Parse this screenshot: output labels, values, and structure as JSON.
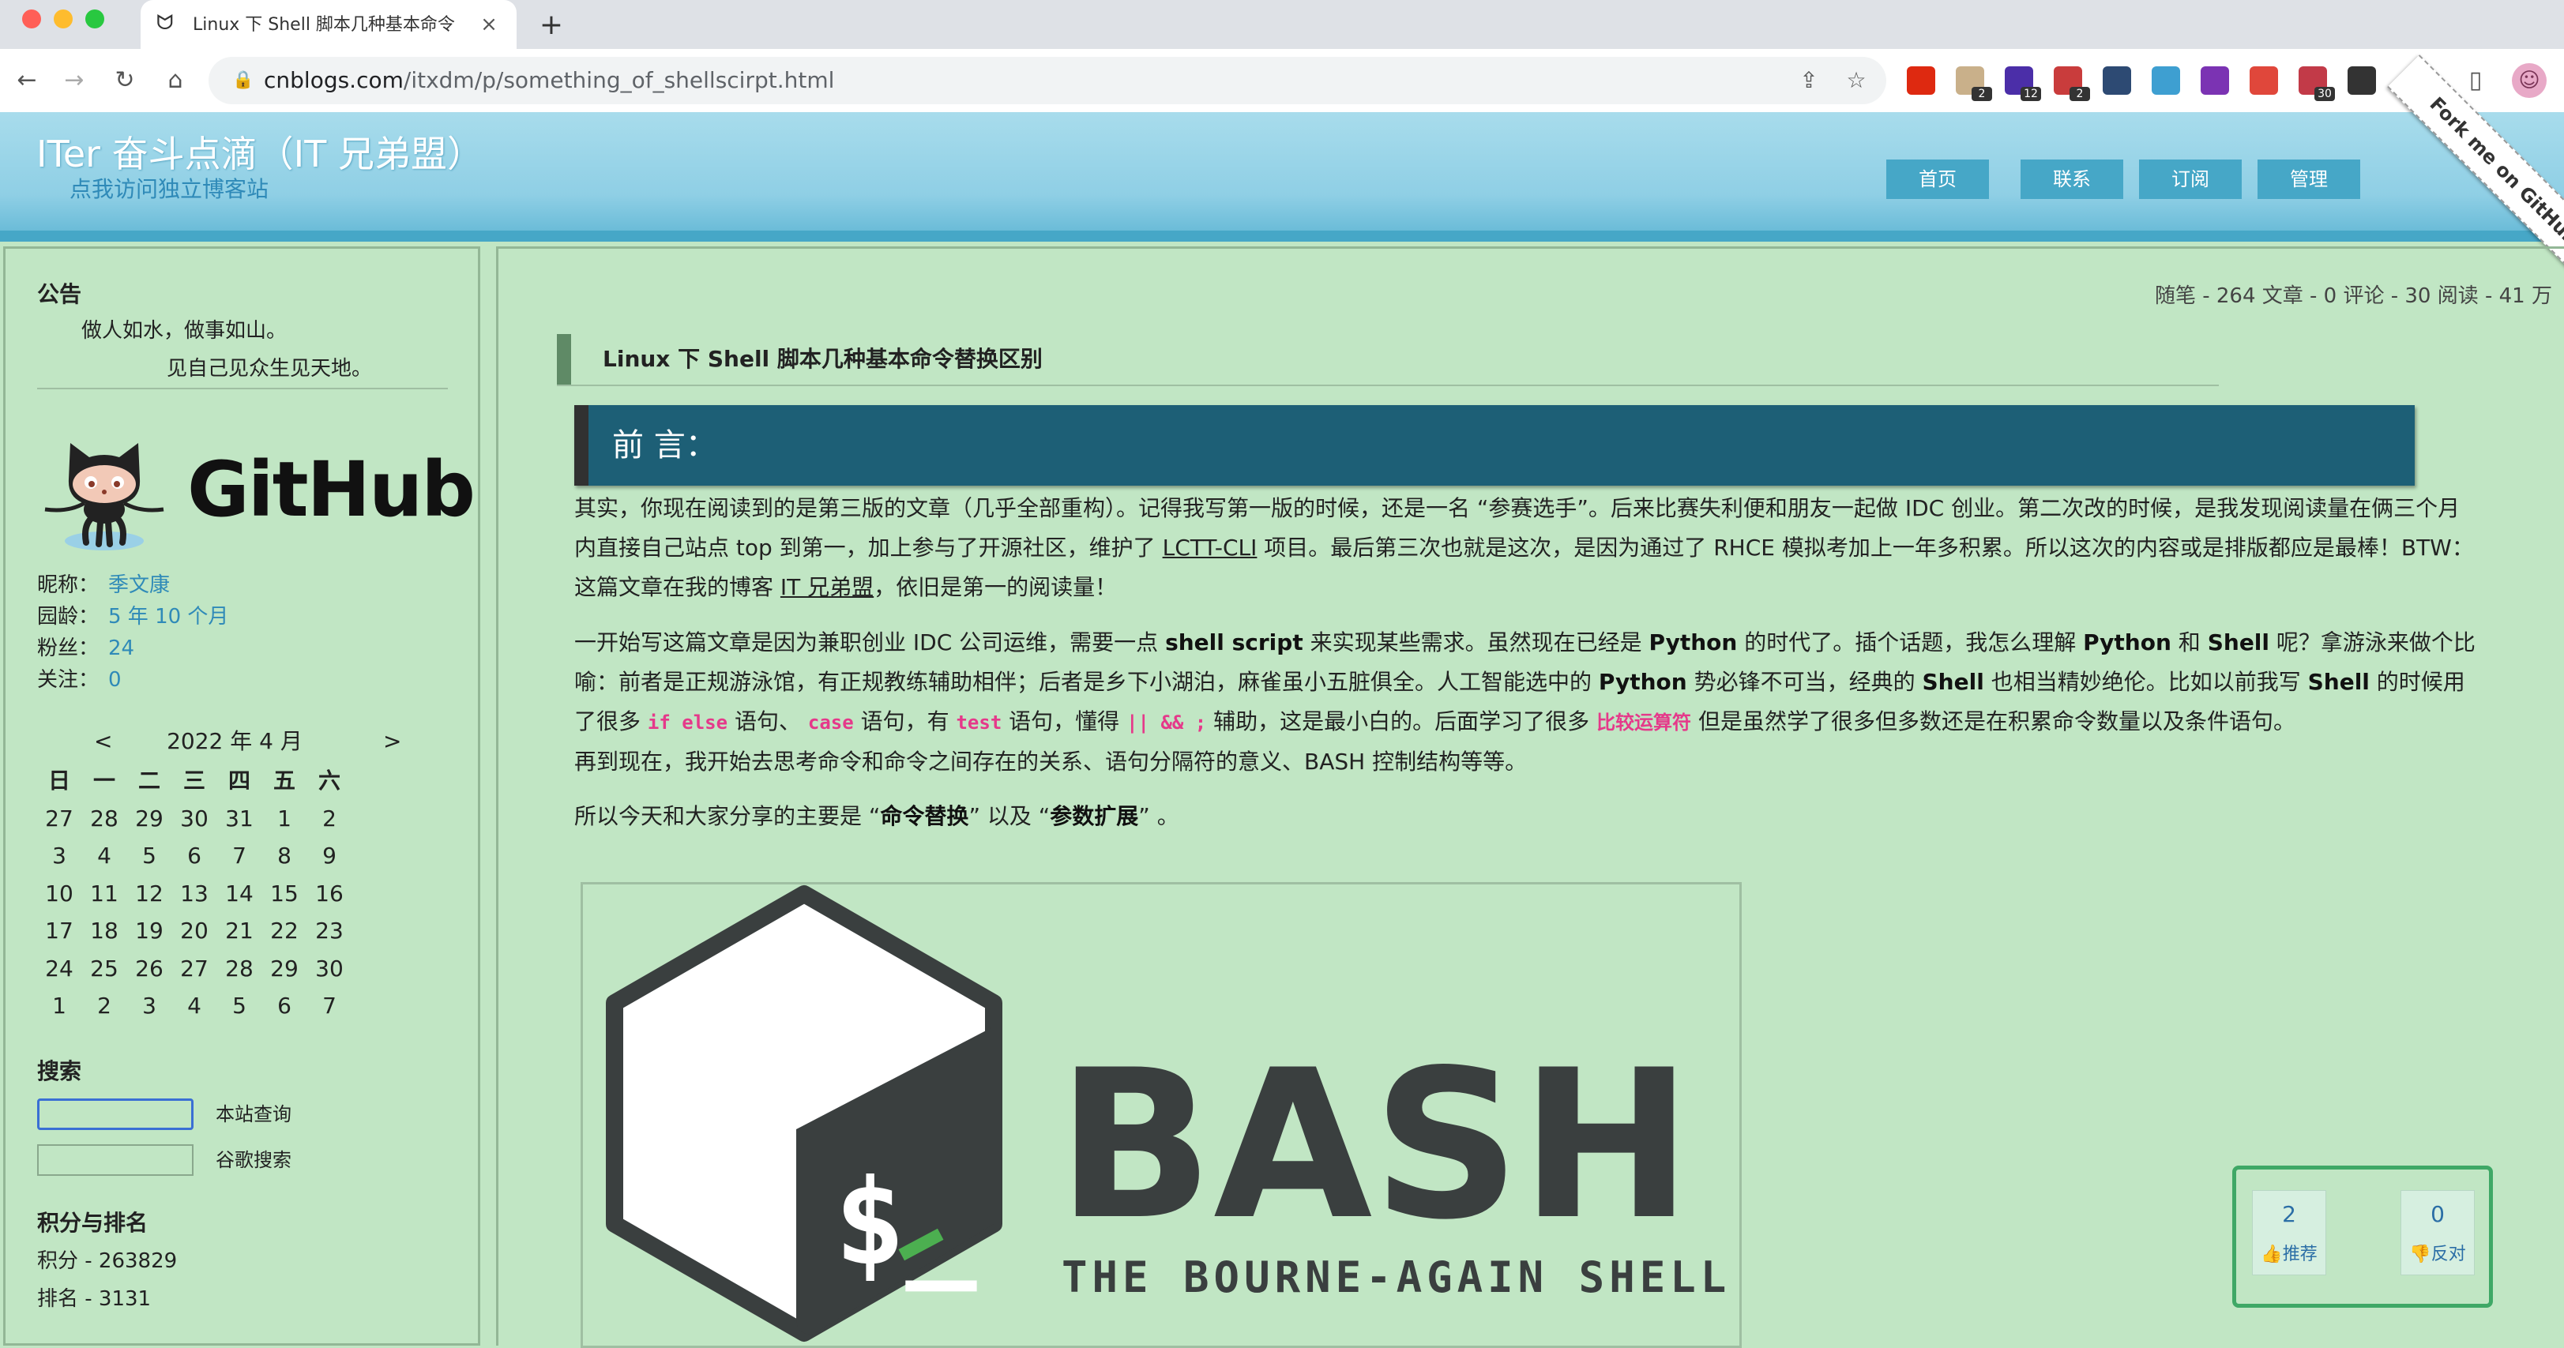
{
  "browser": {
    "tab_title": "Linux 下 Shell 脚本几种基本命令",
    "url_host": "cnblogs.com",
    "url_path": "/itxdm/p/something_of_shellscirpt.html",
    "extensions": [
      {
        "name": "china-flag-icon",
        "color": "#de2910",
        "badge": ""
      },
      {
        "name": "coin-extension-icon",
        "color": "#c9b08a",
        "badge": "2"
      },
      {
        "name": "graduation-cap-icon",
        "color": "#4b2ea8",
        "badge": "12"
      },
      {
        "name": "ring-extension-icon",
        "color": "#c93c3c",
        "badge": "2"
      },
      {
        "name": "cursor-extension-icon",
        "color": "#2d4a73",
        "badge": ""
      },
      {
        "name": "circle-extension-icon",
        "color": "#3e9fd1",
        "badge": ""
      },
      {
        "name": "onenote-icon",
        "color": "#7b33b3",
        "badge": ""
      },
      {
        "name": "note-extension-icon",
        "color": "#e0473b",
        "badge": ""
      },
      {
        "name": "calendar-extension-icon",
        "color": "#c23a48",
        "badge": "30"
      },
      {
        "name": "terminal-extension-icon",
        "color": "#333333",
        "badge": ""
      }
    ]
  },
  "site": {
    "title": "ITer 奋斗点滴（IT 兄弟盟）",
    "subtitle": "点我访问独立博客站",
    "nav": [
      "首页",
      "联系",
      "订阅",
      "管理"
    ],
    "fork_ribbon": "Fork me on GitHub"
  },
  "sidebar": {
    "notice_heading": "公告",
    "notice_line1": "做人如水，做事如山。",
    "notice_line2": "见自己见众生见天地。",
    "github_word": "GitHub",
    "profile": [
      {
        "k": "昵称：",
        "v": "季文康"
      },
      {
        "k": "园龄：",
        "v": "5 年 10 个月"
      },
      {
        "k": "粉丝：",
        "v": "24"
      },
      {
        "k": "关注：",
        "v": "0"
      }
    ],
    "calendar": {
      "prev": "<",
      "next": ">",
      "title": "2022 年 4 月",
      "weekdays": [
        "日",
        "一",
        "二",
        "三",
        "四",
        "五",
        "六"
      ],
      "days": [
        "27",
        "28",
        "29",
        "30",
        "31",
        "1",
        "2",
        "3",
        "4",
        "5",
        "6",
        "7",
        "8",
        "9",
        "10",
        "11",
        "12",
        "13",
        "14",
        "15",
        "16",
        "17",
        "18",
        "19",
        "20",
        "21",
        "22",
        "23",
        "24",
        "25",
        "26",
        "27",
        "28",
        "29",
        "30",
        "1",
        "2",
        "3",
        "4",
        "5",
        "6",
        "7"
      ]
    },
    "search_heading": "搜索",
    "search_site_label": "本站查询",
    "search_google_label": "谷歌搜索",
    "rank_heading": "积分与排名",
    "score": "积分 - 263829",
    "rank": "排名 - 3131"
  },
  "main": {
    "stats": "随笔 - 264  文章 - 0  评论 - 30  阅读 - 41 万",
    "post_title": "Linux 下 Shell 脚本几种基本命令替换区别",
    "section_heading": "前 言：",
    "p1": [
      "其实，你现在阅读到的是第三版的文章（几乎全部重构）。记得我写第一版的时候，还是一名 “参赛选手”。后来比赛失利便和朋友一起做 IDC 创业。第二次改的时候，是我发现阅读量在俩三个月",
      "内直接自己站点 top 到第一，加上参与了开源社区，维护了 ",
      "LCTT-CLI",
      " 项目。最后第三次也就是这次，是因为通过了 RHCE 模拟考加上一年多积累。所以这次的内容或是排版都应是最棒！BTW：",
      "这篇文章在我的博客 ",
      "IT 兄弟盟",
      "，依旧是第一的阅读量！"
    ],
    "p2": [
      "一开始写这篇文章是因为兼职创业 IDC 公司运维，需要一点 ",
      "shell script",
      " 来实现某些需求。虽然现在已经是 ",
      "Python",
      " 的时代了。插个话题，我怎么理解 ",
      "Python",
      " 和 ",
      "Shell",
      " 呢？拿游泳来做个比",
      "喻：前者是正规游泳馆，有正规教练辅助相伴；后者是乡下小湖泊，麻雀虽小五脏俱全。人工智能选中的 ",
      "Python",
      " 势必锋不可当，经典的 ",
      "Shell",
      " 也相当精妙绝伦。比如以前我写 ",
      "Shell",
      " 的时候用",
      "了很多 ",
      "if else",
      " 语句、 ",
      "case",
      " 语句，有 ",
      "test",
      " 语句，懂得 ",
      "||  &&  ;",
      " 辅助，这是最小白的。后面学习了很多 ",
      "比较运算符",
      " 但是虽然学了很多但多数还是在积累命令数量以及条件语句。",
      "再到现在，我开始去思考命令和命令之间存在的关系、语句分隔符的意义、BASH 控制结构等等。"
    ],
    "p3": [
      "所以今天和大家分享的主要是 “",
      "命令替换",
      "” 以及 “",
      "参数扩展",
      "” 。"
    ],
    "bash_logo": {
      "word": "BASH",
      "tagline": "THE BOURNE-AGAIN SHELL",
      "prompt": "$_"
    },
    "vote": {
      "up_count": "2",
      "up_label": "推荐",
      "down_count": "0",
      "down_label": "反对"
    }
  }
}
